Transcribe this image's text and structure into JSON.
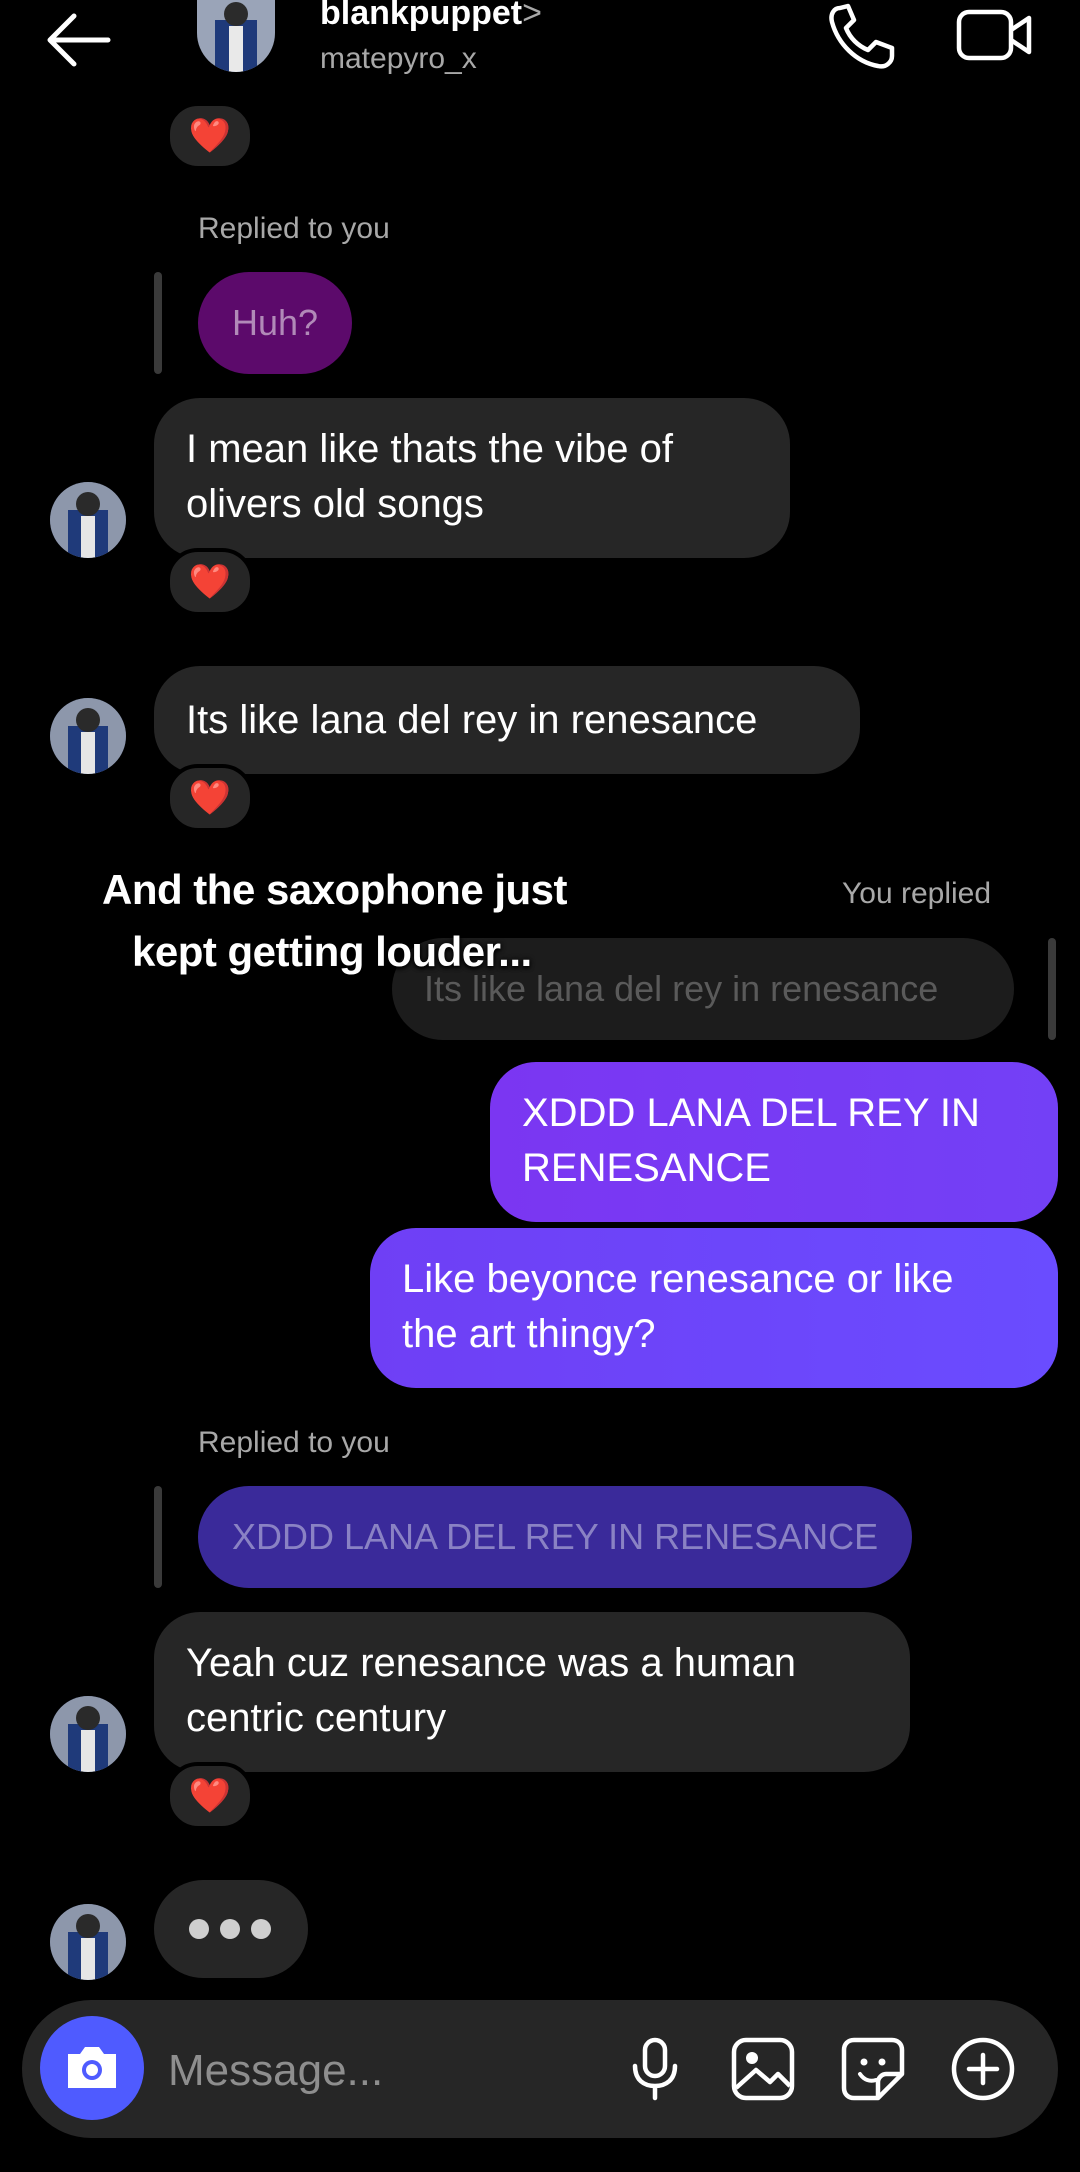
{
  "header": {
    "name": "blankpuppet",
    "chevron": ">",
    "username": "matepyro_x",
    "back_icon": "arrow-left-icon",
    "call_icon": "phone-icon",
    "video_icon": "video-camera-icon"
  },
  "messages": {
    "reply_label_1": "Replied to you",
    "quoted_1": "Huh?",
    "msg_1_line1": "I mean like thats the vibe of",
    "msg_1_line2": "olivers old songs",
    "msg_2": "Its like lana del rey in renesance",
    "you_replied_label": "You replied",
    "quoted_2": "Its like lana del rey in renesance",
    "out_1_line1": "XDDD LANA DEL REY IN",
    "out_1_line2": "RENESANCE",
    "out_2_line1": "Like beyonce renesance or like",
    "out_2_line2": "the art thingy?",
    "reply_label_2": "Replied to you",
    "quoted_3": "XDDD LANA DEL REY IN RENESANCE",
    "msg_3_line1": "Yeah cuz renesance was a human",
    "msg_3_line2": "centric century",
    "reaction": "❤️"
  },
  "overlay": {
    "line1": "And the saxophone just",
    "line2": "kept getting louder..."
  },
  "composer": {
    "placeholder": "Message...",
    "camera_icon": "camera-icon",
    "mic_icon": "microphone-icon",
    "gallery_icon": "image-icon",
    "sticker_icon": "sticker-icon",
    "add_icon": "plus-circle-icon"
  },
  "colors": {
    "incoming_bubble": "#262626",
    "quoted_purple": "#5c0a6b",
    "outgoing_gradient_start": "#7a3cf5",
    "outgoing_gradient_end": "#6a4cff",
    "quoted_outgoing": "#3a2a9a",
    "camera_button": "#4f5bff"
  }
}
